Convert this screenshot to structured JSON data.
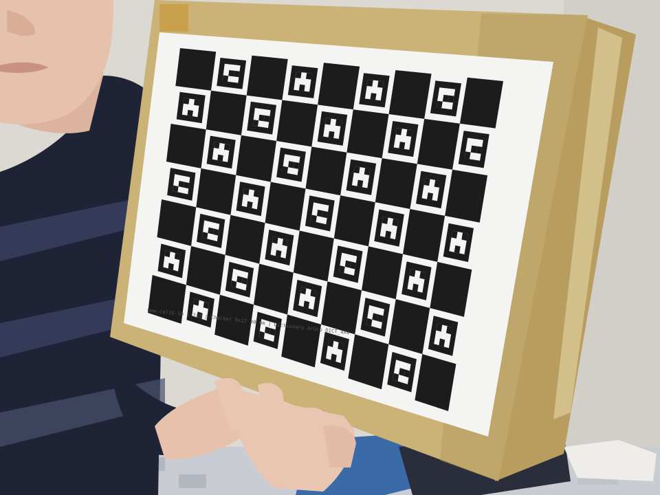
{
  "scene": {
    "board_caption": "www.calib.io | 7x9 | Checker 9x12 30 mm | Dictionary ArUco DICT_4X4",
    "board_cols": 9,
    "board_rows": 7
  },
  "colors": {
    "wall": "#dcd9d2",
    "sweater_dark": "#1f2336",
    "sweater_stripe": "#3a4060",
    "skin": "#e6c2ad",
    "box_gold": "#cbb276",
    "box_gold_dark": "#a88f55",
    "paper": "#f4f4f2",
    "ink": "#1c1c1c"
  }
}
